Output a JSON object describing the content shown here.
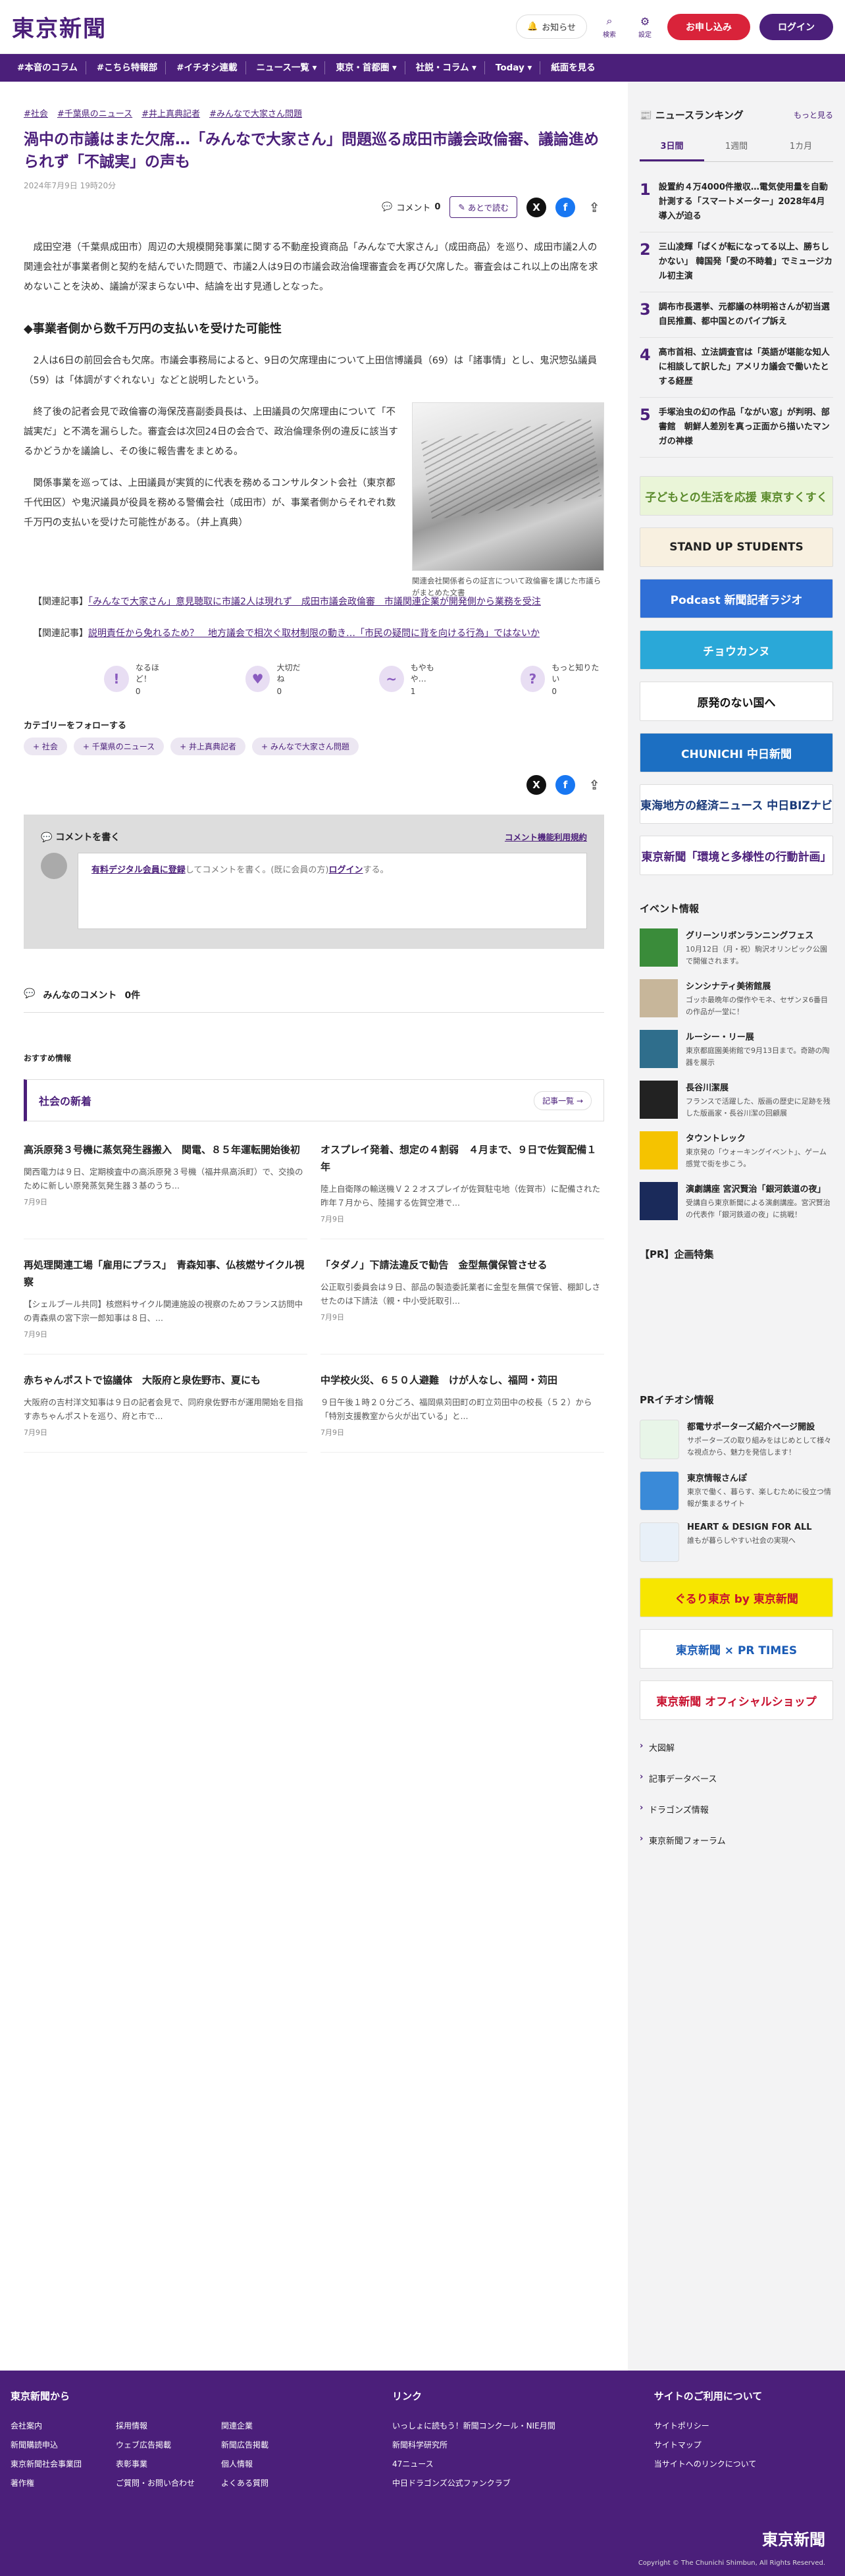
{
  "header": {
    "logo": "東京新聞",
    "notice": "お知らせ",
    "search": "検索",
    "settings": "設定",
    "signup": "お申し込み",
    "login": "ログイン"
  },
  "nav": [
    "#本音のコラム",
    "#こちら特報部",
    "#イチオシ連載",
    "ニュース一覧 ▾",
    "東京・首都圏 ▾",
    "社説・コラム ▾",
    "Today ▾",
    "紙面を見る"
  ],
  "article": {
    "tags": [
      "#社会",
      "#千葉県のニュース",
      "#井上真典記者",
      "#みんなで大家さん問題"
    ],
    "title": "渦中の市議はまた欠席…「みんなで大家さん」問題巡る成田市議会政倫審、議論進められず「不誠実」の声も",
    "date": "2024年7月9日 19時20分",
    "comment_label": "コメント",
    "comment_count": "0",
    "later_label": "あとで読む",
    "p1": "成田空港（千葉県成田市）周辺の大規模開発事業に関する不動産投資商品「みんなで大家さん」（成田商品）を巡り、成田市議2人の関連会社が事業者側と契約を結んでいた問題で、市議2人は9日の市議会政治倫理審査会を再び欠席した。審査会はこれ以上の出席を求めないことを決め、議論が深まらない中、結論を出す見通しとなった。",
    "subhead": "◆事業者側から数千万円の支払いを受けた可能性",
    "p2": "2人は6日の前回会合も欠席。市議会事務局によると、9日の欠席理由について上田信博議員（69）は「諸事情」とし、鬼沢惣弘議員（59）は「体調がすぐれない」などと説明したという。",
    "p3": "終了後の記者会見で政倫審の海保茂喜副委員長は、上田議員の欠席理由について「不誠実だ」と不満を漏らした。審査会は次回24日の会合で、政治倫理条例の違反に該当するかどうかを議論し、その後に報告書をまとめる。",
    "p4": "関係事業を巡っては、上田議員が実質的に代表を務めるコンサルタント会社（東京都千代田区）や鬼沢議員が役員を務める警備会社（成田市）が、事業者側からそれぞれ数千万円の支払いを受けた可能性がある。（井上真典）",
    "caption": "関連会社関係者らの証言について政倫審を講じた市議らがまとめた文書",
    "related_label": "【関連記事】",
    "related": [
      "「みんなで大家さん」意見聴取に市議2人は現れず　成田市議会政倫審　市議関連企業が開発側から業務を受注",
      "説明責任から免れるため？　地方議会で相次ぐ取材制限の動き…「市民の疑問に背を向ける行為」ではないか"
    ]
  },
  "reactions": [
    {
      "label": "なるほど！",
      "count": "0",
      "icon": "!"
    },
    {
      "label": "大切だね",
      "count": "0",
      "icon": "♥"
    },
    {
      "label": "もやもや…",
      "count": "1",
      "icon": "~"
    },
    {
      "label": "もっと知りたい",
      "count": "0",
      "icon": "?"
    }
  ],
  "follow": {
    "title": "カテゴリーをフォローする",
    "tags": [
      "+ 社会",
      "+ 千葉県のニュース",
      "+ 井上真典記者",
      "+ みんなで大家さん問題"
    ]
  },
  "comment_box": {
    "title": "コメントを書く",
    "terms": "コメント機能利用規約",
    "prompt_pre": "有料デジタル会員に登録",
    "prompt_mid": "してコメントを書く。(既に会員の方)",
    "prompt_login": "ログイン",
    "prompt_post": "する。"
  },
  "all_comments": {
    "label": "みんなのコメント",
    "count": "0件"
  },
  "osusume": "おすすめ情報",
  "social": {
    "title": "社会の新着",
    "more": "記事一覧 →",
    "items": [
      {
        "title": "高浜原発３号機に蒸気発生器搬入　関電、８５年運転開始後初",
        "body": "関西電力は９日、定期検査中の高浜原発３号機（福井県高浜町）で、交換のために新しい原発蒸気発生器３基のうち...",
        "date": "7月9日"
      },
      {
        "title": "オスプレイ発着、想定の４割弱　４月まで、９日で佐賀配備１年",
        "body": "陸上自衛隊の輸送機Ｖ２２オスプレイが佐賀駐屯地（佐賀市）に配備された昨年７月から、陸揚する佐賀空港で...",
        "date": "7月9日"
      },
      {
        "title": "再処理関連工場「雇用にプラス」　青森知事、仏核燃サイクル視察",
        "body": "【シェルブール共同】核燃料サイクル関連施設の視察のためフランス訪問中の青森県の宮下宗一郎知事は８日、...",
        "date": "7月9日"
      },
      {
        "title": "「タダノ」下請法違反で勧告　金型無償保管させる",
        "body": "公正取引委員会は９日、部品の製造委託業者に金型を無償で保管、棚卸しさせたのは下請法（親・中小受託取引...",
        "date": "7月9日"
      },
      {
        "title": "赤ちゃんポストで協議体　大阪府と泉佐野市、夏にも",
        "body": "大阪府の吉村洋文知事は９日の記者会見で、同府泉佐野市が運用開始を目指す赤ちゃんポストを巡り、府と市で...",
        "date": "7月9日"
      },
      {
        "title": "中学校火災、６５０人避難　けが人なし、福岡・苅田",
        "body": "９日午後１時２０分ごろ、福岡県苅田町の町立苅田中の校長（５２）から「特別支援教室から火が出ている」と...",
        "date": "7月9日"
      }
    ]
  },
  "ranking": {
    "title": "ニュースランキング",
    "more": "もっと見る",
    "tabs": [
      "3日間",
      "1週間",
      "1カ月"
    ],
    "items": [
      {
        "no": "1",
        "text": "設置約４万4000件撤収…電気使用量を自動計測する「スマートメーター」2028年4月導入が迫る"
      },
      {
        "no": "2",
        "text": "三山凌輝「ぱくが転になってる以上、勝ちしかない」 韓国発「愛の不時着」でミュージカル初主演"
      },
      {
        "no": "3",
        "text": "調布市長選挙、元都議の林明裕さんが初当選　自民推薦、都中国とのパイプ訴え"
      },
      {
        "no": "4",
        "text": "高市首相、立法調査官は「英語が堪能な知人に相談して訳した」アメリカ議会で働いたとする経歴"
      },
      {
        "no": "5",
        "text": "手塚治虫の幻の作品「ながい窓」が判明、部書館　朝鮮人差別を真っ正面から描いたマンガの神様"
      }
    ]
  },
  "banners": [
    {
      "label": "子どもとの生活を応援 東京すくすく",
      "bg": "#eaf5d8",
      "fg": "#5a8a2a"
    },
    {
      "label": "STAND UP STUDENTS",
      "bg": "#f8f0e0",
      "fg": "#222"
    },
    {
      "label": "Podcast 新聞記者ラジオ",
      "bg": "#2f6fd6",
      "fg": "#fff"
    },
    {
      "label": "チョウカンヌ",
      "bg": "#2aa8d8",
      "fg": "#fff"
    },
    {
      "label": "原発のない国へ",
      "bg": "#ffffff",
      "fg": "#111"
    },
    {
      "label": "CHUNICHI 中日新聞",
      "bg": "#1c6fc2",
      "fg": "#fff"
    },
    {
      "label": "東海地方の経済ニュース 中日BIZナビ",
      "bg": "#ffffff",
      "fg": "#1a3a7a"
    },
    {
      "label": "東京新聞「環境と多様性の行動計画」",
      "bg": "#ffffff",
      "fg": "#4b1f7a"
    }
  ],
  "events": {
    "title": "イベント情報",
    "items": [
      {
        "title": "グリーンリボンランニングフェス",
        "desc": "10月12日（月・祝）駒沢オリンピック公園で開催されます。",
        "color": "#3a8c3a"
      },
      {
        "title": "シンシナティ美術館展",
        "desc": "ゴッホ最晩年の傑作やモネ、セザンヌ6番目の作品が一堂に！",
        "color": "#c7b69a"
      },
      {
        "title": "ルーシー・リー展",
        "desc": "東京都庭園美術館で9月13日まで。奇跡の陶器を展示",
        "color": "#2f6e8c"
      },
      {
        "title": "長谷川潔展",
        "desc": "フランスで活躍した、版画の歴史に足跡を残した版画家・長谷川潔の回顧展",
        "color": "#222"
      },
      {
        "title": "タウントレック",
        "desc": "東京発の「ウォーキングイベント」、ゲーム感覚で街を歩こう。",
        "color": "#f5c300"
      },
      {
        "title": "演劇講座 宮沢賢治「銀河鉄道の夜」",
        "desc": "受講自ら東京新聞による演劇講座。宮沢賢治の代表作「銀河鉄道の夜」に挑戦！",
        "color": "#1a2a5a"
      }
    ]
  },
  "pr_planning": "【PR】企画特集",
  "pr_ichioshi": {
    "title": "PRイチオシ情報",
    "items": [
      {
        "title": "都電サポーターズ紹介ページ開設",
        "desc": "サポーターズの取り組みをはじめとして様々な視点から、魅力を発信します！",
        "color": "#e8f5e8"
      },
      {
        "title": "東京情報さんぽ",
        "desc": "東京で働く、暮らす、楽しむために役立つ情報が集まるサイト",
        "color": "#3a8ad8"
      },
      {
        "title": "HEART & DESIGN FOR ALL",
        "desc": "誰もが暮らしやすい社会の実現へ",
        "color": "#e8f0f8"
      }
    ]
  },
  "pr_banners": [
    {
      "label": "ぐるり東京 by 東京新聞",
      "bg": "#f7e600",
      "fg": "#c8102e"
    },
    {
      "label": "東京新聞 × PR TIMES",
      "bg": "#ffffff",
      "fg": "#1a5bb5"
    },
    {
      "label": "東京新聞 オフィシャルショップ",
      "bg": "#ffffff",
      "fg": "#c8102e"
    }
  ],
  "side_links": [
    "大図解",
    "記事データベース",
    "ドラゴンズ情報",
    "東京新聞フォーラム"
  ],
  "footer": {
    "col1_title": "東京新聞から",
    "col1": [
      "会社案内",
      "採用情報",
      "関連企業",
      "新聞購読申込",
      "ウェブ広告掲載",
      "新聞広告掲載",
      "東京新聞社会事業団",
      "表彰事業",
      "個人情報",
      "著作権",
      "ご質問・お問い合わせ",
      "よくある質問"
    ],
    "col2_title": "リンク",
    "col2": [
      "いっしょに読もう！新聞コンクール・NIE月間",
      "新聞科学研究所",
      "47ニュース",
      "中日ドラゴンズ公式ファンクラブ"
    ],
    "col3_title": "サイトのご利用について",
    "col3": [
      "サイトポリシー",
      "サイトマップ",
      "当サイトへのリンクについて"
    ],
    "logo": "東京新聞",
    "copyright": "Copyright © The Chunichi Shimbun, All Rights Reserved."
  }
}
